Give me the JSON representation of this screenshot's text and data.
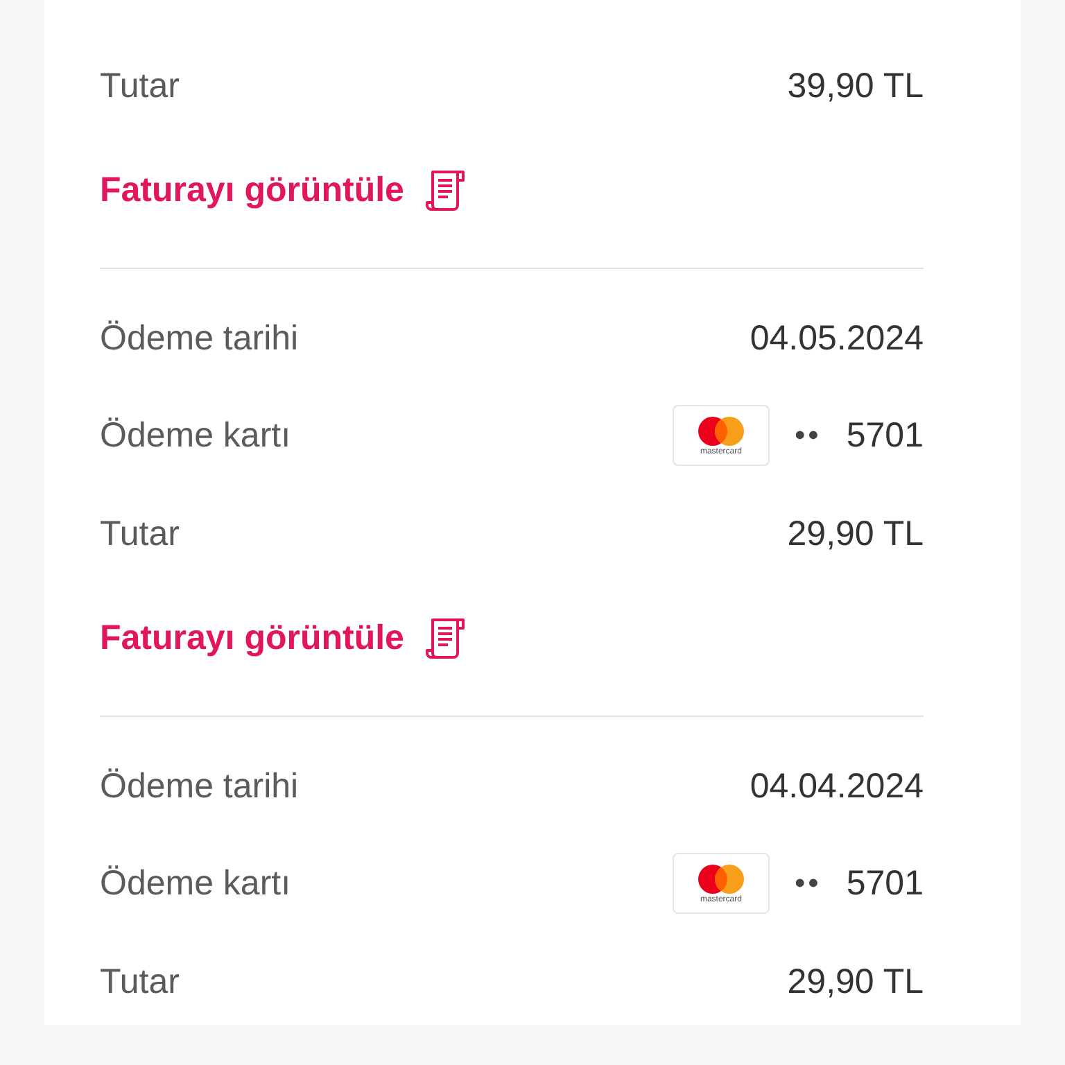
{
  "payments": [
    {
      "amount_label": "Tutar",
      "amount": "39,90 TL",
      "invoice_link": "Faturayı görüntüle"
    },
    {
      "date_label": "Ödeme tarihi",
      "date": "04.05.2024",
      "card_label": "Ödeme kartı",
      "card_brand": "mastercard",
      "card_mask": "••",
      "card_last4": "5701",
      "amount_label": "Tutar",
      "amount": "29,90 TL",
      "invoice_link": "Faturayı görüntüle"
    },
    {
      "date_label": "Ödeme tarihi",
      "date": "04.04.2024",
      "card_label": "Ödeme kartı",
      "card_brand": "mastercard",
      "card_mask": "••",
      "card_last4": "5701",
      "amount_label": "Tutar",
      "amount": "29,90 TL"
    }
  ]
}
